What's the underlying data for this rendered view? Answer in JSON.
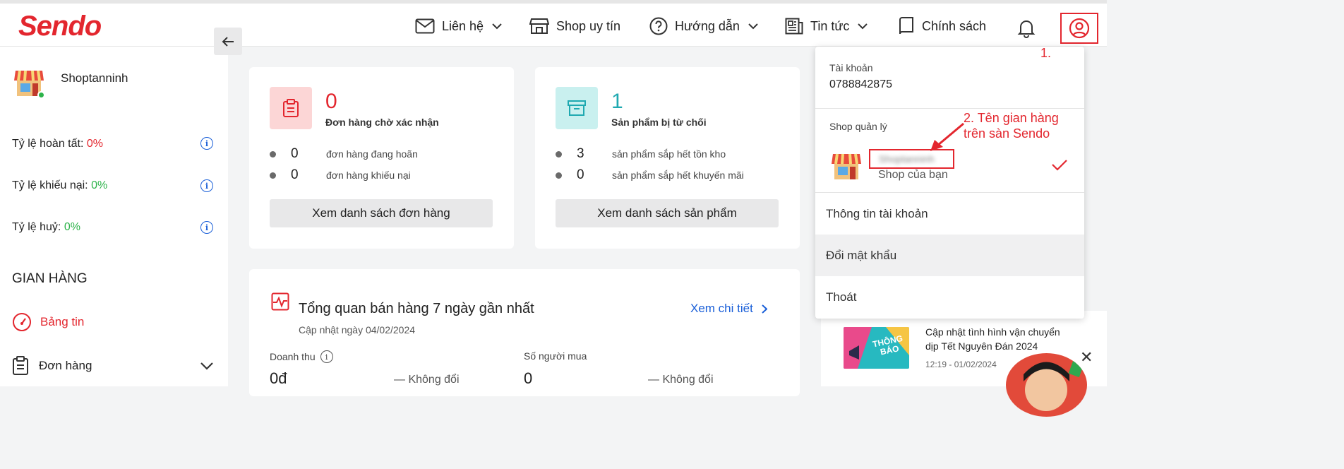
{
  "header": {
    "logo": "Sendo",
    "nav": [
      {
        "label": "Liên hệ"
      },
      {
        "label": "Shop uy tín"
      },
      {
        "label": "Hướng dẫn"
      },
      {
        "label": "Tin tức"
      },
      {
        "label": "Chính sách"
      }
    ]
  },
  "sidebar": {
    "shop_name": "Shoptanninh",
    "rates": [
      {
        "label": "Tỷ lệ hoàn tất:",
        "value": "0%"
      },
      {
        "label": "Tỷ lệ khiếu nại:",
        "value": "0%"
      },
      {
        "label": "Tỷ lệ huỷ:",
        "value": "0%"
      }
    ],
    "section_title": "GIAN HÀNG",
    "menu": [
      {
        "label": "Bảng tin"
      },
      {
        "label": "Đơn hàng"
      }
    ]
  },
  "orders_card": {
    "count": "0",
    "label": "Đơn hàng chờ xác nhận",
    "rows": [
      {
        "n": "0",
        "text": "đơn hàng đang hoãn"
      },
      {
        "n": "0",
        "text": "đơn hàng khiếu nại"
      }
    ],
    "button": "Xem danh sách đơn hàng"
  },
  "products_card": {
    "count": "1",
    "label": "Sản phẩm bị từ chối",
    "rows": [
      {
        "n": "3",
        "text": "sản phẩm sắp hết tồn kho"
      },
      {
        "n": "0",
        "text": "sản phẩm sắp hết khuyến mãi"
      }
    ],
    "button": "Xem danh sách sản phẩm"
  },
  "overview": {
    "title": "Tổng quan bán hàng 7 ngày gần nhất",
    "updated": "Cập nhật ngày 04/02/2024",
    "link": "Xem chi tiết",
    "metrics": [
      {
        "label": "Doanh thu",
        "value": "0đ",
        "change": "— Không đổi"
      },
      {
        "label": "Số người mua",
        "value": "0",
        "change": "— Không đổi"
      }
    ]
  },
  "news": {
    "thumb_text": "THÔNG BÁO",
    "title": "Cập nhật tình hình vận chuyển dịp Tết Nguyên Đán 2024",
    "time": "12:19 - 01/02/2024"
  },
  "dropdown": {
    "account_label": "Tài khoản",
    "phone": "0788842875",
    "shop_section": "Shop quản lý",
    "shop_name": "Shoptanninh",
    "shop_sub": "Shop của bạn",
    "items": [
      {
        "label": "Thông tin tài khoản"
      },
      {
        "label": "Đổi mật khẩu"
      },
      {
        "label": "Thoát"
      }
    ]
  },
  "annotations": {
    "one": "1.",
    "two_line1": "2. Tên gian hàng",
    "two_line2": "trên sàn Sendo"
  },
  "colors": {
    "brand_red": "#e3262e",
    "link_blue": "#1a5fd8",
    "teal": "#27b9c0",
    "green": "#2db34a"
  }
}
